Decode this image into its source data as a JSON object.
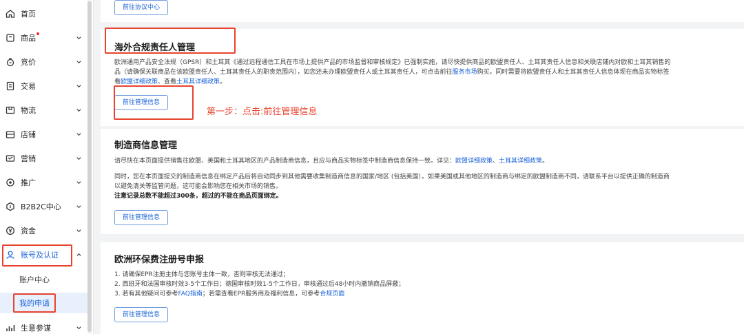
{
  "sidebar": {
    "items": [
      {
        "label": "首页",
        "icon": "home-icon"
      },
      {
        "label": "商品",
        "icon": "product-icon"
      },
      {
        "label": "竞价",
        "icon": "bid-icon"
      },
      {
        "label": "交易",
        "icon": "trade-icon"
      },
      {
        "label": "物流",
        "icon": "logistics-icon"
      },
      {
        "label": "店铺",
        "icon": "store-icon"
      },
      {
        "label": "营销",
        "icon": "marketing-icon"
      },
      {
        "label": "推广",
        "icon": "promotion-icon"
      },
      {
        "label": "B2B2C中心",
        "icon": "b2b2c-icon"
      },
      {
        "label": "资金",
        "icon": "funds-icon"
      },
      {
        "label": "账号及认证",
        "icon": "account-icon"
      },
      {
        "label": "生意参谋",
        "icon": "analytics-icon"
      }
    ],
    "sub_items": [
      {
        "label": "账户中心"
      },
      {
        "label": "我的申请"
      }
    ]
  },
  "top_card": {
    "button_label": "前往协议中心"
  },
  "gpsr_card": {
    "title": "海外合规责任人管理",
    "line1": "欧洲通用产品安全法规（GPSR）和土耳其《通过远程通信工具在市场上提供产品的市场监督和审核规定》已强制实施，请尽快提供商品的欧盟责任人、土耳其责任人信息和关联店铺内对欧和土耳其销售的",
    "line2_a": "品（请确保关联商品在该欧盟责任人、土耳其责任人的职责范围内），如您还未办理欧盟责任人或土耳其责任人，可点击前往",
    "line2_link": "服务市场",
    "line2_b": "购买。同时需要将欧盟责任人和土耳其责任人信息体现在商品实物标签",
    "line3_a": "看",
    "line3_link1": "欧盟详细政策",
    "line3_b": "、查看",
    "line3_link2": "土耳其详细政策",
    "line3_c": "。",
    "button_label": "前往管理信息"
  },
  "annotation": {
    "text": "第一步：点击:前往管理信息"
  },
  "manufacturer_card": {
    "title": "制造商信息管理",
    "p1_a": "请尽快在本页面提供销售往欧盟、美国和土耳其地区的产品制造商信息，且应与商品实物标签中制造商信息保持一致。详见：",
    "p1_link1": "欧盟详细政策",
    "p1_b": "、",
    "p1_link2": "土耳其详细政策",
    "p1_c": "。",
    "p2_line1": "同时，您在本页面提交的制造商信息在绑定产品后将自动同步到其他需要收集制造商信息的国家/地区 (包括美国）。如果美国或其他地区的制造商与绑定的欧盟制造商不同，请联系平台以提供正确的制造商",
    "p2_line2": "以避免清关等监管问题，这可能会影响您在相关市场的销售。",
    "p3": "注意记录总数不能超过300条，超过的不能在商品页面绑定。",
    "button_label": "前往管理信息"
  },
  "epr_card": {
    "title": "欧洲环保费注册号申报",
    "l1": "1. 请确保EPR注册主体与您账号主体一致，否则审核无法通过；",
    "l2": "2. 西班牙和法国审核时效3-5个工作日；德国审核时效1-5个工作日，审核通过后48小时内撤销商品屏蔽；",
    "l3_a": "3. 若有其他疑问可参考",
    "l3_link1": "FAQ指南",
    "l3_b": "；若需查看EPR服务商及福利信息，可参考",
    "l3_link2": "合规页面",
    "button_label": "前往管理信息"
  },
  "colors": {
    "accent": "#1a63d8",
    "annotation": "#e8432e",
    "badge": "#f5222d"
  }
}
